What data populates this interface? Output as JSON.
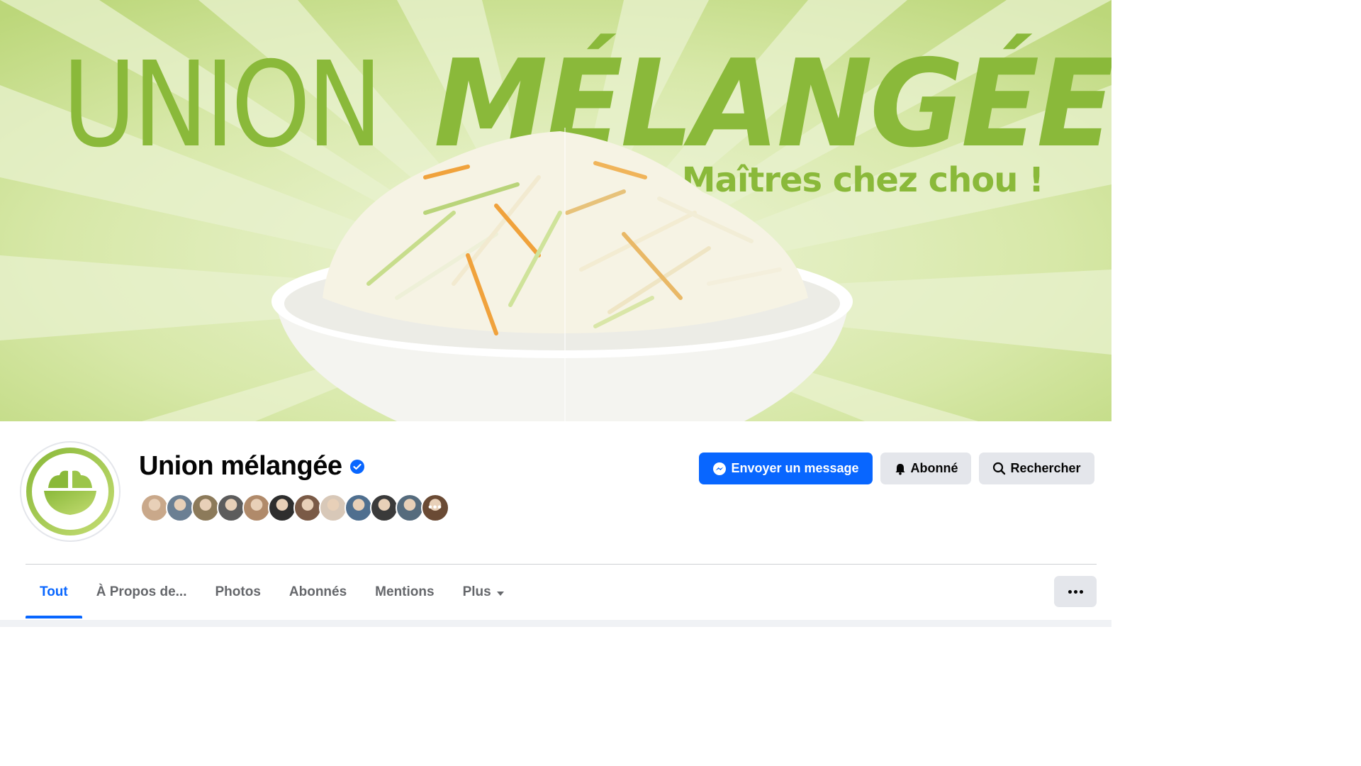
{
  "cover": {
    "brand_light": "UNION",
    "brand_bold": "MÉLANGÉE",
    "tagline": "Maîtres chez chou !"
  },
  "page": {
    "name": "Union mélangée",
    "verified": true
  },
  "followers": {
    "avatar_colors": [
      "#c9a88a",
      "#6b7f93",
      "#8c7a5a",
      "#5c5c5c",
      "#b08a6a",
      "#2e2e2e",
      "#7a5a46",
      "#d8c8b8",
      "#4f6f8f",
      "#3a3a3a",
      "#556b7d",
      "#6a4a34"
    ],
    "more_glyph": "•••"
  },
  "actions": {
    "message_label": "Envoyer un message",
    "follow_label": "Abonné",
    "search_label": "Rechercher"
  },
  "tabs": [
    {
      "label": "Tout",
      "active": true
    },
    {
      "label": "À Propos de...",
      "active": false
    },
    {
      "label": "Photos",
      "active": false
    },
    {
      "label": "Abonnés",
      "active": false
    },
    {
      "label": "Mentions",
      "active": false
    },
    {
      "label": "Plus",
      "active": false,
      "has_caret": true
    }
  ],
  "colors": {
    "accent": "#0866ff",
    "brand_green": "#8ab93a",
    "cover_light": "#e8f1cc",
    "cover_mid": "#bcd77a"
  }
}
